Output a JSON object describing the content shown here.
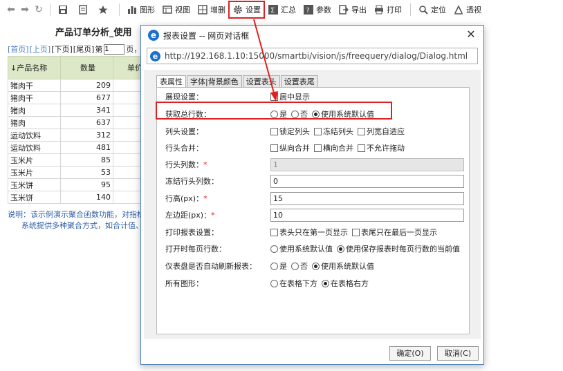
{
  "toolbar": {
    "back_glyph": "⬅",
    "forward_glyph": "➡",
    "refresh_glyph": "↻",
    "items": [
      {
        "key": "save",
        "label": ""
      },
      {
        "key": "saveas",
        "label": ""
      },
      {
        "key": "favorite",
        "label": ""
      },
      {
        "key": "chart",
        "label": "图形"
      },
      {
        "key": "view",
        "label": "视图"
      },
      {
        "key": "adddel",
        "label": "增删"
      },
      {
        "key": "settings",
        "label": "设置"
      },
      {
        "key": "summary",
        "label": "汇总"
      },
      {
        "key": "params",
        "label": "参数"
      },
      {
        "key": "export",
        "label": "导出"
      },
      {
        "key": "print",
        "label": "打印"
      },
      {
        "key": "locate",
        "label": "定位"
      },
      {
        "key": "pivot",
        "label": "透视"
      }
    ]
  },
  "report": {
    "title": "产品订单分析_使用",
    "pager": {
      "first": "[首页]",
      "prev": "[上页]",
      "next": "[下页]",
      "last": "[尾页]",
      "page_prefix": "第",
      "page_value": "1",
      "page_suffix": "页，共"
    },
    "columns": [
      "↓产品名称",
      "数量",
      "单价"
    ],
    "rows": [
      [
        "猪肉干",
        "209"
      ],
      [
        "猪肉干",
        "677"
      ],
      [
        "猪肉",
        "341"
      ],
      [
        "猪肉",
        "637"
      ],
      [
        "运动饮料",
        "312"
      ],
      [
        "运动饮料",
        "481"
      ],
      [
        "玉米片",
        "85"
      ],
      [
        "玉米片",
        "53"
      ],
      [
        "玉米饼",
        "95"
      ],
      [
        "玉米饼",
        "140"
      ]
    ],
    "note_line1": "说明：该示例演示聚合函数功能，对指标",
    "note_line2": "系统提供多种聚合方式，如合计值、"
  },
  "dialog": {
    "title": "报表设置 -- 网页对话框",
    "close_glyph": "✕",
    "url": "http://192.168.1.10:15000/smartbi/vision/js/freequery/dialog/Dialog.html",
    "tabs": [
      "表属性",
      "字体|背景颜色",
      "设置表头",
      "设置表尾"
    ],
    "fields": {
      "display": {
        "label": "展现设置：",
        "option": "居中显示"
      },
      "total_rows": {
        "label": "获取总行数：",
        "options": [
          "是",
          "否",
          "使用系统默认值"
        ],
        "selected": 2
      },
      "column_header": {
        "label": "列头设置：",
        "options": [
          "锁定列头",
          "冻结列头",
          "列宽自适应"
        ]
      },
      "row_merge": {
        "label": "行头合并：",
        "options": [
          "纵向合并",
          "横向合并",
          "不允许拖动"
        ]
      },
      "header_cols": {
        "label": "行头列数：",
        "required": "*",
        "value": "1"
      },
      "frozen_cols": {
        "label": "冻结行头列数：",
        "value": "0"
      },
      "row_height": {
        "label": "行高(px)：",
        "required": "*",
        "value": "15"
      },
      "left_margin": {
        "label": "左边距(px)：",
        "required": "*",
        "value": "10"
      },
      "print_settings": {
        "label": "打印报表设置：",
        "options": [
          "表头只在第一页显示",
          "表尾只在最后一页显示"
        ]
      },
      "page_rows": {
        "label": "打开时每页行数：",
        "options": [
          "使用系统默认值",
          "使用保存报表时每页行数的当前值"
        ],
        "selected": 1
      },
      "auto_refresh": {
        "label": "仪表盘是否自动刷新报表：",
        "options": [
          "是",
          "否",
          "使用系统默认值"
        ],
        "selected": 2
      },
      "all_charts": {
        "label": "所有图形：",
        "options": [
          "在表格下方",
          "在表格右方"
        ],
        "selected": 1
      }
    },
    "ok_label": "确定(O)",
    "cancel_label": "取消(C)"
  },
  "colors": {
    "highlight": "#e02020",
    "header_bg": "#dce8c7",
    "link": "#4a7fc0"
  }
}
